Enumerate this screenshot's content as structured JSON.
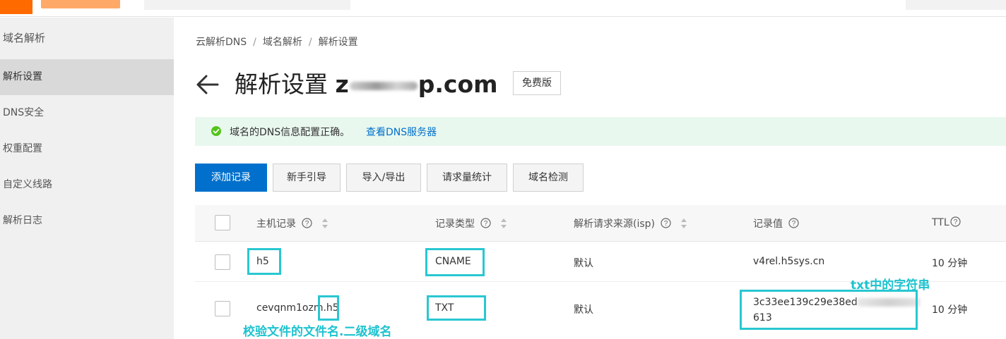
{
  "sidebar": {
    "title": "域名解析",
    "items": [
      {
        "label": "解析设置",
        "active": true
      },
      {
        "label": "DNS安全"
      },
      {
        "label": "权重配置"
      },
      {
        "label": "自定义线路"
      },
      {
        "label": "解析日志"
      }
    ]
  },
  "breadcrumb": [
    "云解析DNS",
    "域名解析",
    "解析设置"
  ],
  "breadcrumb_sep": "/",
  "page": {
    "title_prefix": "解析设置",
    "domain_start": "z",
    "domain_end": "p.com",
    "plan_badge": "免费版"
  },
  "notice": {
    "message": "域名的DNS信息配置正确。",
    "link": "查看DNS服务器",
    "color": "#52c41a"
  },
  "toolbar": {
    "add_record": "添加记录",
    "guide": "新手引导",
    "import_export": "导入/导出",
    "query_stats": "请求量统计",
    "domain_check": "域名检测"
  },
  "table": {
    "headers": {
      "host": "主机记录",
      "type": "记录类型",
      "line": "解析请求来源(isp)",
      "value": "记录值",
      "ttl": "TTL"
    },
    "rows": [
      {
        "host": "h5",
        "type": "CNAME",
        "line": "默认",
        "value": "v4rel.h5sys.cn",
        "ttl": "10 分钟"
      },
      {
        "host_prefix": "cevqnm1ozm.",
        "host_suffix": "h5",
        "type": "TXT",
        "line": "默认",
        "value_line1": "3c33ee139c29e38ed",
        "value_line2": "613",
        "ttl": "10 分钟"
      }
    ]
  },
  "annotations": {
    "txt_label": "txt中的字符串",
    "filename_label": "校验文件的文件名.二级域名",
    "color": "#29c7d1"
  },
  "colors": {
    "primary": "#0070cc",
    "brand": "#ff6a00"
  }
}
